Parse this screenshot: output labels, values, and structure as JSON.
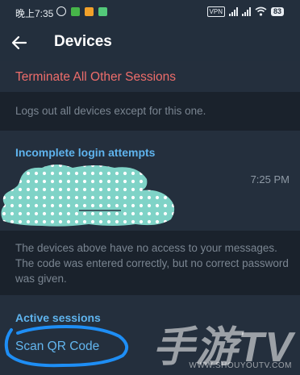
{
  "status_bar": {
    "time": "晚上7:35",
    "vpn": "VPN",
    "battery": "83"
  },
  "toolbar": {
    "title": "Devices"
  },
  "actions": {
    "terminate_label": "Terminate All Other Sessions",
    "terminate_hint": "Logs out all devices except for this one."
  },
  "incomplete_login": {
    "header": "Incomplete login attempts",
    "attempt_time": "7:25 PM",
    "note": "The devices above have no access to your messages. The code was entered correctly, but no correct password was given."
  },
  "active_sessions": {
    "header": "Active sessions",
    "scan_qr_label": "Scan QR Code"
  },
  "watermark": {
    "text": "手游TV",
    "url": "WWW.SHOUYOUTV.COM"
  },
  "colors": {
    "accent_blue": "#5fb4ee",
    "destructive_red": "#ee6d6b",
    "background": "#1d2733"
  }
}
